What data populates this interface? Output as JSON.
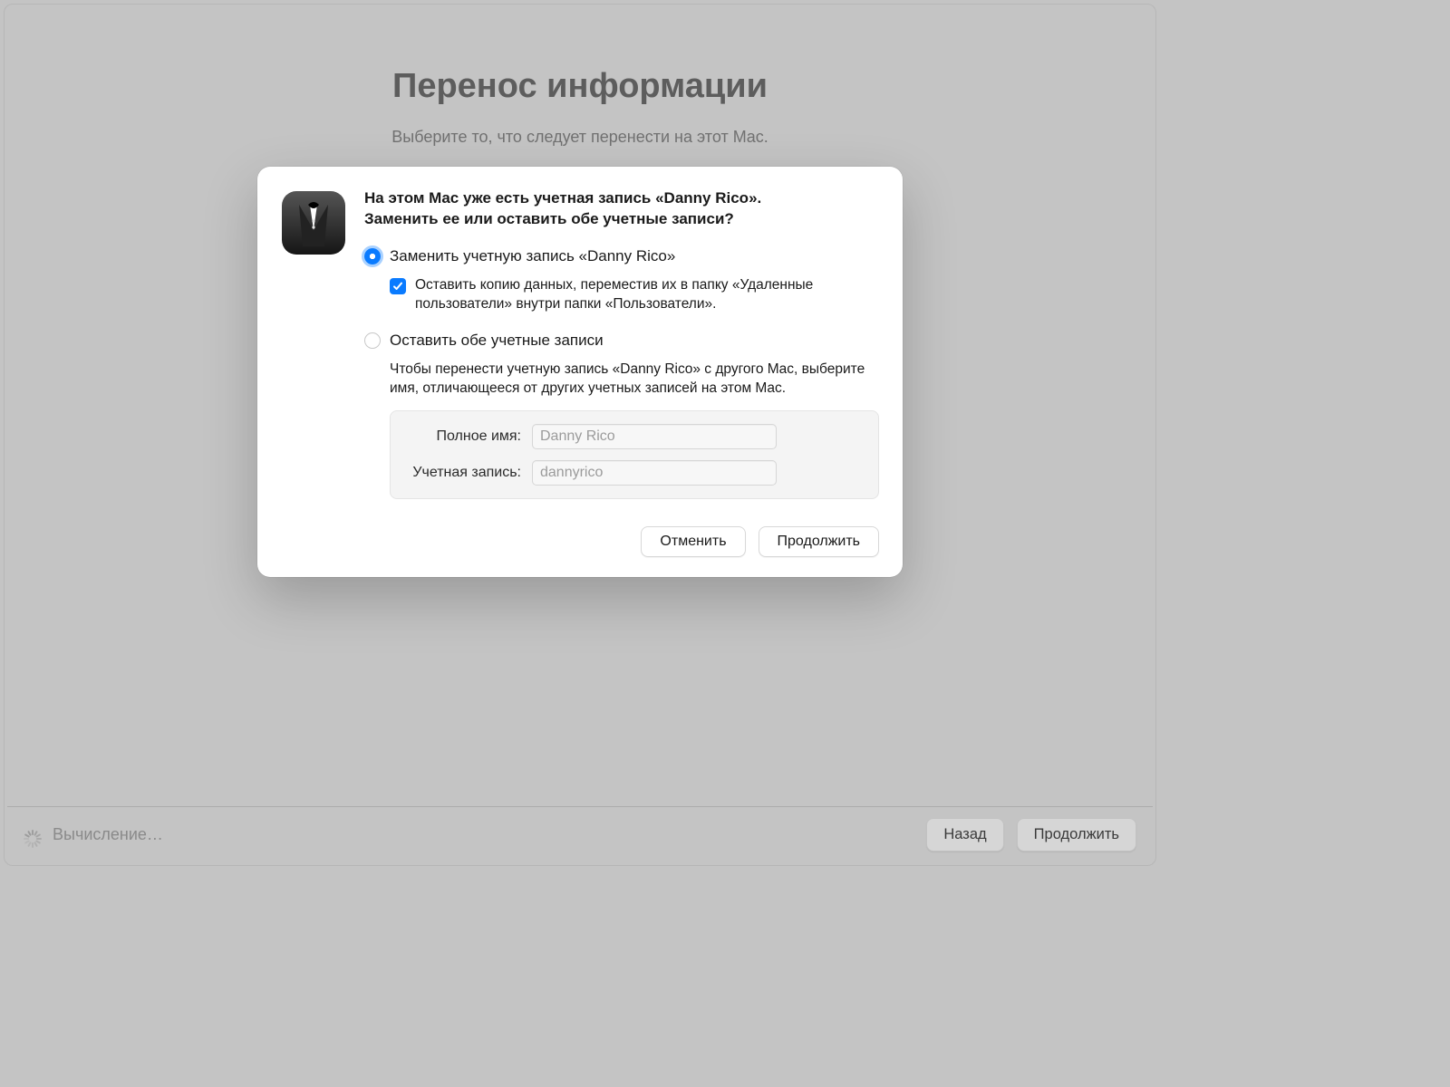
{
  "page": {
    "title": "Перенос информации",
    "subtitle": "Выберите то, что следует перенести на этот Mac."
  },
  "modal": {
    "icon": "tuxedo-icon",
    "heading_line1": "На этом Mac уже есть учетная запись «Danny Rico».",
    "heading_line2": "Заменить ее или оставить обе учетные записи?",
    "option_replace": {
      "label": "Заменить учетную запись «Danny Rico»",
      "selected": true,
      "keep_copy": {
        "checked": true,
        "label": "Оставить копию данных, переместив их в папку «Удаленные пользователи» внутри папки «Пользователи»."
      }
    },
    "option_keep_both": {
      "label": "Оставить обе учетные записи",
      "selected": false,
      "info": "Чтобы перенести учетную запись «Danny Rico» с другого Mac, выберите имя, отличающееся от других учетных записей на этом Mac.",
      "form": {
        "full_name_label": "Полное имя:",
        "full_name_value": "Danny Rico",
        "account_label": "Учетная запись:",
        "account_value": "dannyrico"
      }
    },
    "buttons": {
      "cancel": "Отменить",
      "continue": "Продолжить"
    }
  },
  "footer": {
    "status": "Вычисление…",
    "back": "Назад",
    "continue": "Продолжить"
  }
}
